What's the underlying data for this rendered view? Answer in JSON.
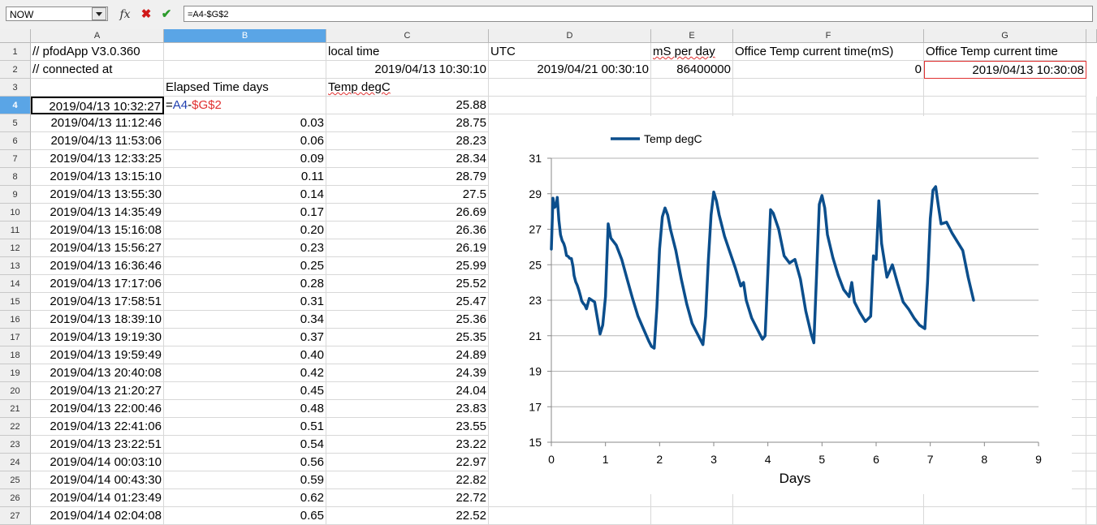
{
  "name_box": "NOW",
  "formula": "=A4-$G$2",
  "columns": [
    "A",
    "B",
    "C",
    "D",
    "E",
    "F",
    "G"
  ],
  "row_numbers": [
    "1",
    "2",
    "3",
    "4",
    "5",
    "6",
    "7",
    "8",
    "9",
    "10",
    "11",
    "12",
    "13",
    "14",
    "15",
    "16",
    "17",
    "18",
    "19",
    "20",
    "21",
    "22",
    "23",
    "24",
    "25",
    "26",
    "27"
  ],
  "cells": {
    "A1": "// pfodApp V3.0.360",
    "C1": "local time",
    "D1": "UTC",
    "E1": "mS per day",
    "F1": "Office Temp current time(mS)",
    "G1": "Office Temp current time",
    "A2": "// connected at",
    "C2": "2019/04/13 10:30:10",
    "D2": "2019/04/21 00:30:10",
    "E2": "86400000",
    "F2": "0",
    "G2": "2019/04/13 10:30:08",
    "B3": "Elapsed Time days",
    "C3": "Temp degC",
    "B4_ref1": "A4",
    "B4_minus": "-",
    "B4_ref2": "$G$2"
  },
  "rows": [
    {
      "a": "2019/04/13 10:32:27",
      "b": "",
      "c": "25.88"
    },
    {
      "a": "2019/04/13 11:12:46",
      "b": "0.03",
      "c": "28.75"
    },
    {
      "a": "2019/04/13 11:53:06",
      "b": "0.06",
      "c": "28.23"
    },
    {
      "a": "2019/04/13 12:33:25",
      "b": "0.09",
      "c": "28.34"
    },
    {
      "a": "2019/04/13 13:15:10",
      "b": "0.11",
      "c": "28.79"
    },
    {
      "a": "2019/04/13 13:55:30",
      "b": "0.14",
      "c": "27.5"
    },
    {
      "a": "2019/04/13 14:35:49",
      "b": "0.17",
      "c": "26.69"
    },
    {
      "a": "2019/04/13 15:16:08",
      "b": "0.20",
      "c": "26.36"
    },
    {
      "a": "2019/04/13 15:56:27",
      "b": "0.23",
      "c": "26.19"
    },
    {
      "a": "2019/04/13 16:36:46",
      "b": "0.25",
      "c": "25.99"
    },
    {
      "a": "2019/04/13 17:17:06",
      "b": "0.28",
      "c": "25.52"
    },
    {
      "a": "2019/04/13 17:58:51",
      "b": "0.31",
      "c": "25.47"
    },
    {
      "a": "2019/04/13 18:39:10",
      "b": "0.34",
      "c": "25.36"
    },
    {
      "a": "2019/04/13 19:19:30",
      "b": "0.37",
      "c": "25.35"
    },
    {
      "a": "2019/04/13 19:59:49",
      "b": "0.40",
      "c": "24.89"
    },
    {
      "a": "2019/04/13 20:40:08",
      "b": "0.42",
      "c": "24.39"
    },
    {
      "a": "2019/04/13 21:20:27",
      "b": "0.45",
      "c": "24.04"
    },
    {
      "a": "2019/04/13 22:00:46",
      "b": "0.48",
      "c": "23.83"
    },
    {
      "a": "2019/04/13 22:41:06",
      "b": "0.51",
      "c": "23.55"
    },
    {
      "a": "2019/04/13 23:22:51",
      "b": "0.54",
      "c": "23.22"
    },
    {
      "a": "2019/04/14 00:03:10",
      "b": "0.56",
      "c": "22.97"
    },
    {
      "a": "2019/04/14 00:43:30",
      "b": "0.59",
      "c": "22.82"
    },
    {
      "a": "2019/04/14 01:23:49",
      "b": "0.62",
      "c": "22.72"
    },
    {
      "a": "2019/04/14 02:04:08",
      "b": "0.65",
      "c": "22.52"
    }
  ],
  "colors": {
    "series": "#0b4e8c",
    "selected_header": "#5aa5e6",
    "reference_red": "#e03030",
    "reference_blue": "#1f3fb0"
  },
  "icons": {
    "function_wizard": "fx-icon",
    "cancel": "cancel-icon",
    "accept": "accept-icon"
  },
  "chart_data": {
    "type": "line",
    "title": "",
    "xlabel": "Days",
    "ylabel": "",
    "xlim": [
      0,
      9
    ],
    "ylim": [
      15,
      31
    ],
    "x_ticks": [
      "0",
      "1",
      "2",
      "3",
      "4",
      "5",
      "6",
      "7",
      "8",
      "9"
    ],
    "y_ticks": [
      "15",
      "17",
      "19",
      "21",
      "23",
      "25",
      "27",
      "29",
      "31"
    ],
    "grid": "horizontal",
    "legend": "top",
    "series": [
      {
        "name": "Temp degC",
        "x": [
          0,
          0.03,
          0.06,
          0.09,
          0.11,
          0.14,
          0.17,
          0.2,
          0.23,
          0.25,
          0.28,
          0.31,
          0.34,
          0.37,
          0.4,
          0.42,
          0.45,
          0.48,
          0.51,
          0.54,
          0.56,
          0.59,
          0.62,
          0.65,
          0.7,
          0.8,
          0.9,
          0.95,
          1.0,
          1.05,
          1.1,
          1.2,
          1.3,
          1.4,
          1.5,
          1.6,
          1.7,
          1.8,
          1.85,
          1.9,
          1.95,
          2.0,
          2.05,
          2.1,
          2.15,
          2.2,
          2.3,
          2.4,
          2.5,
          2.6,
          2.7,
          2.8,
          2.85,
          2.9,
          2.95,
          3.0,
          3.05,
          3.1,
          3.2,
          3.3,
          3.4,
          3.5,
          3.55,
          3.6,
          3.7,
          3.8,
          3.9,
          3.95,
          4.0,
          4.05,
          4.1,
          4.2,
          4.3,
          4.4,
          4.5,
          4.6,
          4.7,
          4.8,
          4.85,
          4.9,
          4.95,
          5.0,
          5.05,
          5.1,
          5.2,
          5.3,
          5.4,
          5.5,
          5.55,
          5.6,
          5.7,
          5.8,
          5.9,
          5.95,
          6.0,
          6.05,
          6.1,
          6.2,
          6.3,
          6.4,
          6.5,
          6.6,
          6.7,
          6.8,
          6.9,
          6.95,
          7.0,
          7.05,
          7.1,
          7.15,
          7.2,
          7.3,
          7.4,
          7.5,
          7.6,
          7.7,
          7.8
        ],
        "values": [
          25.88,
          28.75,
          28.23,
          28.34,
          28.79,
          27.5,
          26.69,
          26.36,
          26.19,
          25.99,
          25.52,
          25.47,
          25.36,
          25.35,
          24.89,
          24.39,
          24.04,
          23.83,
          23.55,
          23.22,
          22.97,
          22.82,
          22.72,
          22.52,
          23.1,
          22.9,
          21.1,
          21.6,
          23.2,
          27.3,
          26.5,
          26.1,
          25.3,
          24.2,
          23.1,
          22.1,
          21.4,
          20.7,
          20.4,
          20.3,
          22.6,
          25.9,
          27.7,
          28.2,
          27.8,
          27.0,
          25.8,
          24.2,
          22.8,
          21.7,
          21.1,
          20.5,
          22.1,
          25.2,
          27.8,
          29.1,
          28.6,
          27.8,
          26.6,
          25.7,
          24.8,
          23.8,
          24.0,
          23.0,
          22.0,
          21.4,
          20.8,
          21.0,
          24.6,
          28.1,
          27.9,
          27.0,
          25.5,
          25.1,
          25.3,
          24.2,
          22.4,
          21.1,
          20.6,
          24.5,
          28.4,
          28.9,
          28.2,
          26.7,
          25.4,
          24.4,
          23.6,
          23.2,
          24.0,
          22.9,
          22.3,
          21.8,
          22.1,
          25.5,
          25.3,
          28.6,
          26.2,
          24.3,
          25.0,
          23.9,
          22.9,
          22.5,
          22.0,
          21.6,
          21.4,
          24.0,
          27.6,
          29.2,
          29.4,
          28.3,
          27.3,
          27.4,
          26.8,
          26.3,
          25.8,
          24.3,
          23.0
        ]
      }
    ]
  }
}
